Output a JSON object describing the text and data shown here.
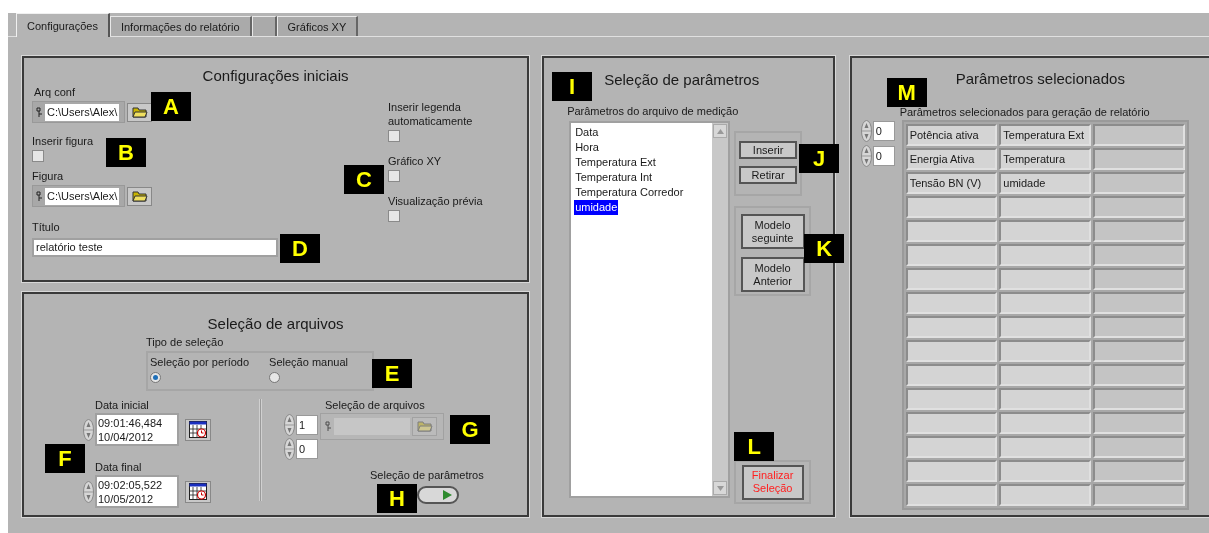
{
  "tabs": [
    {
      "kind": "text",
      "label": "Configurações",
      "selected": true
    },
    {
      "kind": "text",
      "label": "Informações do relatório",
      "selected": false
    },
    {
      "kind": "blank",
      "selected": false
    },
    {
      "kind": "text",
      "label": "Gráficos XY",
      "selected": false
    }
  ],
  "initial_config": {
    "title": "Configurações iniciais",
    "arq_conf": {
      "label": "Arq conf",
      "value": "C:\\Users\\Alex\\",
      "callout": "A"
    },
    "insert_figure": {
      "label": "Inserir figura",
      "checked": false,
      "callout": "B"
    },
    "figure": {
      "label": "Figura",
      "value": "C:\\Users\\Alex\\"
    },
    "title_field": {
      "label": "Título",
      "value": "relatório teste",
      "callout": "D"
    },
    "options": [
      {
        "label": "Inserir legenda automaticamente",
        "checked": false
      },
      {
        "label": "Gráfico XY",
        "checked": false
      },
      {
        "label": "Visualização prévia",
        "checked": false
      }
    ],
    "options_callout": "C"
  },
  "file_selection": {
    "title": "Seleção de arquivos",
    "selection_type": {
      "label": "Tipo de seleção",
      "callout": "E",
      "options": [
        {
          "label": "Seleção por período",
          "selected": true
        },
        {
          "label": "Seleção manual",
          "selected": false
        }
      ]
    },
    "start_date": {
      "label": "Data inicial",
      "time": "09:01:46,484",
      "date": "10/04/2012"
    },
    "end_date": {
      "label": "Data final",
      "time": "09:02:05,522",
      "date": "10/05/2012"
    },
    "dates_callout": "F",
    "files": {
      "label": "Seleção de arquivos",
      "index_1": "1",
      "index_2": "0",
      "callout": "G"
    },
    "parameters_button": {
      "label": "Seleção de parâmetros",
      "callout": "H"
    }
  },
  "parameter_selection": {
    "title": "Seleção de parâmetros",
    "callout": "I",
    "list_label": "Parâmetros do arquivo de medição",
    "items": [
      {
        "label": "Data",
        "selected": false
      },
      {
        "label": "Hora",
        "selected": false
      },
      {
        "label": "Temperatura Ext",
        "selected": false
      },
      {
        "label": "Temperatura Int",
        "selected": false
      },
      {
        "label": "Temperatura Corredor",
        "selected": false
      },
      {
        "label": "umidade",
        "selected": true
      }
    ],
    "buttons": [
      "Inserir",
      "Retirar"
    ],
    "buttons_callout": "J",
    "model_buttons": [
      "Modelo seguinte",
      "Modelo Anterior"
    ],
    "model_callout": "K",
    "finish_button": "Finalizar Seleção",
    "finish_callout": "L"
  },
  "selected_parameters": {
    "title": "Parâmetros selecionados",
    "callout": "M",
    "table_label": "Parâmetros selecionados para geração de relatório",
    "indices": [
      "0",
      "0"
    ],
    "rows": [
      [
        "Potência ativa",
        "Temperatura Ext"
      ],
      [
        "Energia Ativa",
        "Temperatura"
      ],
      [
        "Tensão BN (V)",
        "umidade"
      ]
    ]
  }
}
